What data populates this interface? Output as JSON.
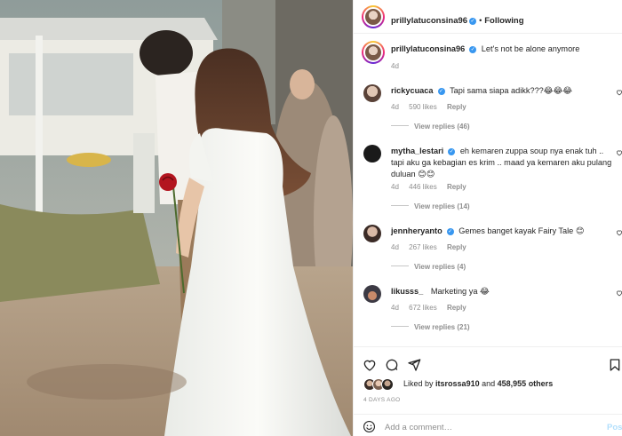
{
  "post": {
    "author": "prillylatuconsina96",
    "follow_status": "Following",
    "dot": "•",
    "caption": "Let's not be alone anymore",
    "caption_time": "4d"
  },
  "comments": [
    {
      "user": "rickycuaca",
      "verified": true,
      "text": "Tapi sama siapa adikk???😂😂😂",
      "time": "4d",
      "likes": "590 likes",
      "reply": "Reply",
      "view_replies": "View replies (46)"
    },
    {
      "user": "mytha_lestari",
      "verified": true,
      "text": "eh kemaren zuppa soup nya enak tuh .. tapi aku ga kebagian es krim .. maad ya kemaren aku pulang duluan 😊😊",
      "time": "4d",
      "likes": "446 likes",
      "reply": "Reply",
      "view_replies": "View replies (14)"
    },
    {
      "user": "jennheryanto",
      "verified": true,
      "text": "Gemes banget kayak Fairy Tale 😊",
      "time": "4d",
      "likes": "267 likes",
      "reply": "Reply",
      "view_replies": "View replies (4)"
    },
    {
      "user": "likusss_",
      "verified": false,
      "text": "Marketing ya 😂",
      "time": "4d",
      "likes": "672 likes",
      "reply": "Reply",
      "view_replies": "View replies (21)"
    }
  ],
  "footer": {
    "liked_prefix": "Liked by",
    "liked_user": "itsrossa910",
    "liked_and": "and",
    "liked_count": "458,955 others",
    "days_ago": "4 DAYS AGO",
    "add_comment_placeholder": "Add a comment…",
    "post_label": "Post"
  },
  "icons": {
    "verified": "verified-badge-icon",
    "heart": "heart-icon",
    "comment": "comment-icon",
    "share": "share-icon",
    "save": "bookmark-icon",
    "emoji": "emoji-icon"
  },
  "colors": {
    "verified_blue": "#3897f0",
    "meta_gray": "#8e8e8e",
    "post_disabled": "#b2dffc"
  }
}
